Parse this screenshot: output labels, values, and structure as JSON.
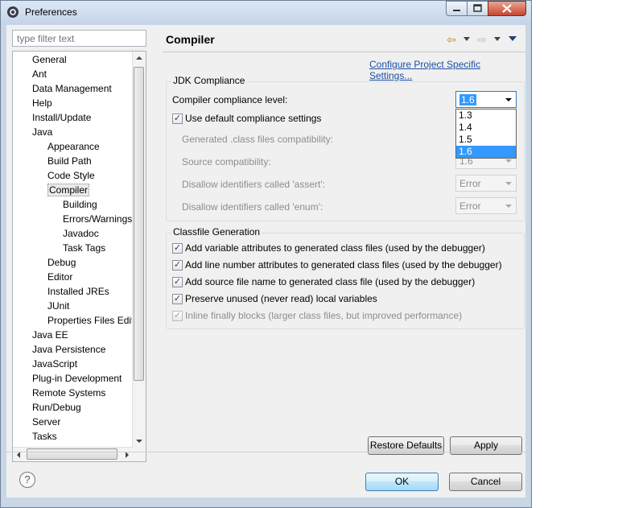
{
  "window": {
    "title": "Preferences",
    "icon": "eclipse-gear-icon"
  },
  "filter": {
    "placeholder": "type filter text"
  },
  "tree": {
    "items": [
      {
        "label": "General",
        "level": 0
      },
      {
        "label": "Ant",
        "level": 0
      },
      {
        "label": "Data Management",
        "level": 0
      },
      {
        "label": "Help",
        "level": 0
      },
      {
        "label": "Install/Update",
        "level": 0
      },
      {
        "label": "Java",
        "level": 0
      },
      {
        "label": "Appearance",
        "level": 1
      },
      {
        "label": "Build Path",
        "level": 1
      },
      {
        "label": "Code Style",
        "level": 1
      },
      {
        "label": "Compiler",
        "level": 1,
        "selected": true
      },
      {
        "label": "Building",
        "level": 2
      },
      {
        "label": "Errors/Warnings",
        "level": 2
      },
      {
        "label": "Javadoc",
        "level": 2
      },
      {
        "label": "Task Tags",
        "level": 2
      },
      {
        "label": "Debug",
        "level": 1
      },
      {
        "label": "Editor",
        "level": 1
      },
      {
        "label": "Installed JREs",
        "level": 1
      },
      {
        "label": "JUnit",
        "level": 1
      },
      {
        "label": "Properties Files Edito",
        "level": 1
      },
      {
        "label": "Java EE",
        "level": 0
      },
      {
        "label": "Java Persistence",
        "level": 0
      },
      {
        "label": "JavaScript",
        "level": 0
      },
      {
        "label": "Plug-in Development",
        "level": 0
      },
      {
        "label": "Remote Systems",
        "level": 0
      },
      {
        "label": "Run/Debug",
        "level": 0
      },
      {
        "label": "Server",
        "level": 0
      },
      {
        "label": "Tasks",
        "level": 0
      }
    ]
  },
  "page": {
    "title": "Compiler",
    "project_link": "Configure Project Specific Settings...",
    "jdk": {
      "group_title": "JDK Compliance",
      "compliance_label": "Compiler compliance level:",
      "compliance_value": "1.6",
      "compliance_options": [
        "1.3",
        "1.4",
        "1.5",
        "1.6"
      ],
      "use_default": "Use default compliance settings",
      "generated_label": "Generated .class files compatibility:",
      "source_label": "Source compatibility:",
      "source_value": "1.6",
      "assert_label": "Disallow identifiers called 'assert':",
      "assert_value": "Error",
      "enum_label": "Disallow identifiers called 'enum':",
      "enum_value": "Error"
    },
    "classfile": {
      "group_title": "Classfile Generation",
      "options": [
        {
          "label": "Add variable attributes to generated class files (used by the debugger)",
          "checked": true,
          "enabled": true
        },
        {
          "label": "Add line number attributes to generated class files (used by the debugger)",
          "checked": true,
          "enabled": true
        },
        {
          "label": "Add source file name to generated class file (used by the debugger)",
          "checked": true,
          "enabled": true
        },
        {
          "label": "Preserve unused (never read) local variables",
          "checked": true,
          "enabled": true
        },
        {
          "label": "Inline finally blocks (larger class files, but improved performance)",
          "checked": true,
          "enabled": false
        }
      ]
    }
  },
  "buttons": {
    "restore_defaults": "Restore Defaults",
    "apply": "Apply",
    "ok": "OK",
    "cancel": "Cancel",
    "help_glyph": "?"
  },
  "glyphs": {
    "check": "✓",
    "back": "⇦",
    "forward": "⇨"
  }
}
